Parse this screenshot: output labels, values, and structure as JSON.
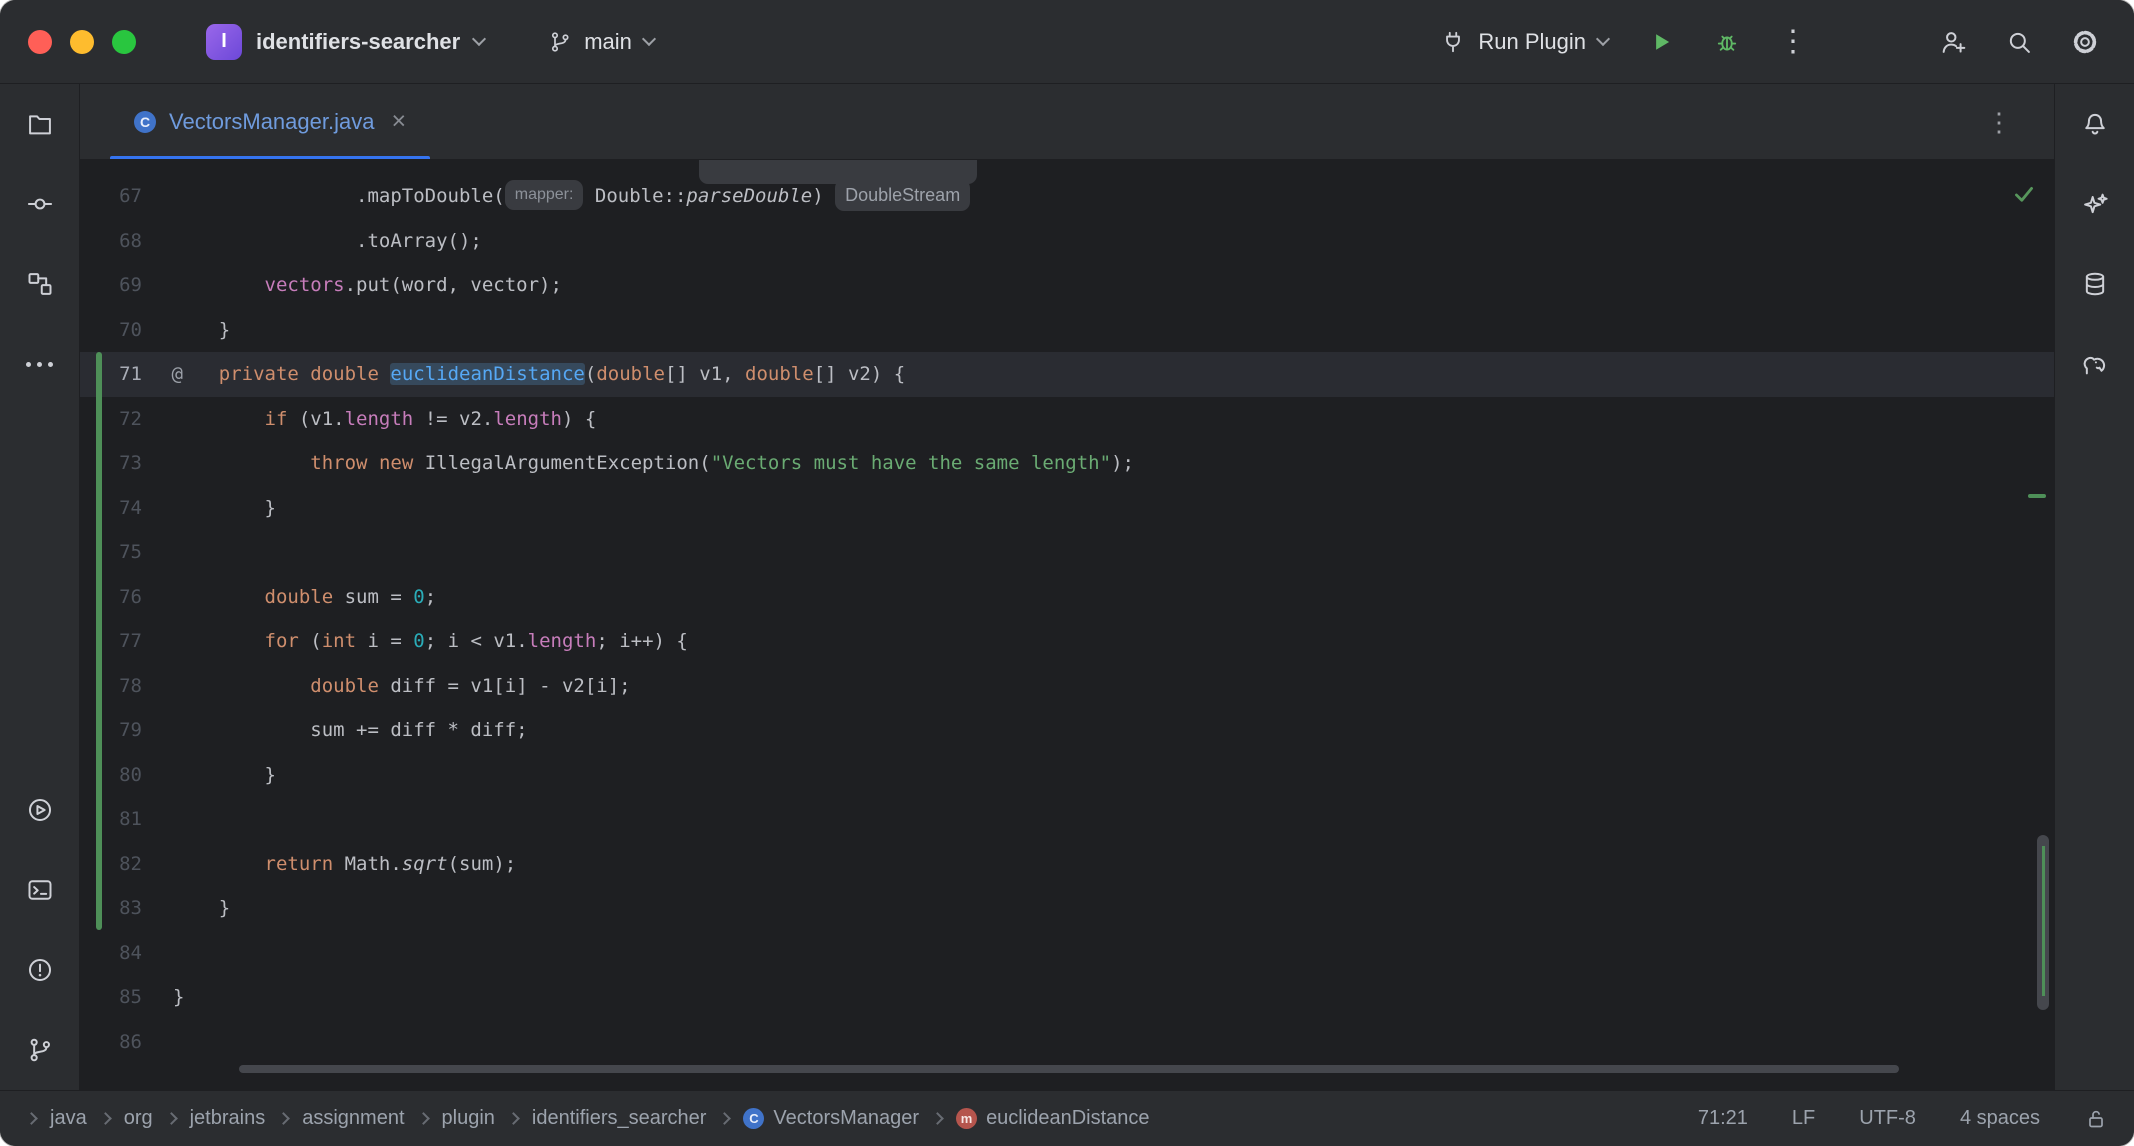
{
  "titlebar": {
    "project_name": "identifiers-searcher",
    "project_icon_letter": "I",
    "branch_name": "main",
    "run_config_label": "Run Plugin"
  },
  "tabbar": {
    "active_tab": "VectorsManager.java",
    "active_tab_icon_letter": "C",
    "close_glyph": "×",
    "kebab_glyph": "⋮"
  },
  "editor": {
    "current_line": 71,
    "annotation_glyph": "@",
    "lines": [
      {
        "no": 67,
        "segs": [
          [
            "d",
            "                .mapToDouble("
          ],
          [
            "inlay",
            "mapper:"
          ],
          [
            "d",
            " Double::"
          ],
          [
            "it",
            "parseDouble"
          ],
          [
            "d",
            ") "
          ],
          [
            "inlay2",
            "DoubleStream"
          ]
        ]
      },
      {
        "no": 68,
        "segs": [
          [
            "d",
            "                .toArray();"
          ]
        ]
      },
      {
        "no": 69,
        "segs": [
          [
            "d",
            "        "
          ],
          [
            "f",
            "vectors"
          ],
          [
            "d",
            ".put(word, vector);"
          ]
        ]
      },
      {
        "no": 70,
        "segs": [
          [
            "d",
            "    }"
          ]
        ]
      },
      {
        "no": 71,
        "annotation": true,
        "segs": [
          [
            "d",
            "    "
          ],
          [
            "k",
            "private"
          ],
          [
            "d",
            " "
          ],
          [
            "k",
            "double"
          ],
          [
            "d",
            " "
          ],
          [
            "decl",
            "euclideanDistance"
          ],
          [
            "d",
            "("
          ],
          [
            "k",
            "double"
          ],
          [
            "d",
            "[] v1, "
          ],
          [
            "k",
            "double"
          ],
          [
            "d",
            "[] v2) {"
          ]
        ]
      },
      {
        "no": 72,
        "segs": [
          [
            "d",
            "        "
          ],
          [
            "k",
            "if"
          ],
          [
            "d",
            " (v1."
          ],
          [
            "f",
            "length"
          ],
          [
            "d",
            " != v2."
          ],
          [
            "f",
            "length"
          ],
          [
            "d",
            ") {"
          ]
        ]
      },
      {
        "no": 73,
        "segs": [
          [
            "d",
            "            "
          ],
          [
            "k",
            "throw"
          ],
          [
            "d",
            " "
          ],
          [
            "k",
            "new"
          ],
          [
            "d",
            " IllegalArgumentException("
          ],
          [
            "s",
            "\"Vectors must have the same length\""
          ],
          [
            "d",
            ");"
          ]
        ]
      },
      {
        "no": 74,
        "segs": [
          [
            "d",
            "        }"
          ]
        ]
      },
      {
        "no": 75,
        "segs": []
      },
      {
        "no": 76,
        "segs": [
          [
            "d",
            "        "
          ],
          [
            "k",
            "double"
          ],
          [
            "d",
            " sum = "
          ],
          [
            "n",
            "0"
          ],
          [
            "d",
            ";"
          ]
        ]
      },
      {
        "no": 77,
        "segs": [
          [
            "d",
            "        "
          ],
          [
            "k",
            "for"
          ],
          [
            "d",
            " ("
          ],
          [
            "k",
            "int"
          ],
          [
            "d",
            " i = "
          ],
          [
            "n",
            "0"
          ],
          [
            "d",
            "; i < v1."
          ],
          [
            "f",
            "length"
          ],
          [
            "d",
            "; i++) {"
          ]
        ]
      },
      {
        "no": 78,
        "segs": [
          [
            "d",
            "            "
          ],
          [
            "k",
            "double"
          ],
          [
            "d",
            " diff = v1[i] - v2[i];"
          ]
        ]
      },
      {
        "no": 79,
        "segs": [
          [
            "d",
            "            sum += diff * diff;"
          ]
        ]
      },
      {
        "no": 80,
        "segs": [
          [
            "d",
            "        }"
          ]
        ]
      },
      {
        "no": 81,
        "segs": []
      },
      {
        "no": 82,
        "segs": [
          [
            "d",
            "        "
          ],
          [
            "k",
            "return"
          ],
          [
            "d",
            " Math."
          ],
          [
            "it",
            "sqrt"
          ],
          [
            "d",
            "(sum);"
          ]
        ]
      },
      {
        "no": 83,
        "segs": [
          [
            "d",
            "    }"
          ]
        ]
      },
      {
        "no": 84,
        "segs": []
      },
      {
        "no": 85,
        "segs": [
          [
            "d",
            "}"
          ]
        ]
      },
      {
        "no": 86,
        "segs": []
      }
    ]
  },
  "statusbar": {
    "breadcrumbs": [
      {
        "label": "java"
      },
      {
        "label": "org"
      },
      {
        "label": "jetbrains"
      },
      {
        "label": "assignment"
      },
      {
        "label": "plugin"
      },
      {
        "label": "identifiers_searcher"
      },
      {
        "label": "VectorsManager",
        "icon": "class",
        "icon_letter": "C"
      },
      {
        "label": "euclideanDistance",
        "icon": "method",
        "icon_letter": "m"
      }
    ],
    "caret_position": "71:21",
    "line_separator": "LF",
    "encoding": "UTF-8",
    "indent": "4 spaces"
  },
  "colors": {
    "accent": "#3574f0",
    "keyword": "#cf8e6d",
    "string": "#6aab73",
    "number": "#2aacb8",
    "field": "#c77dbb",
    "declaration": "#56a8f5",
    "run_green": "#5fb865",
    "change_marker_green": "#4e8f58"
  }
}
